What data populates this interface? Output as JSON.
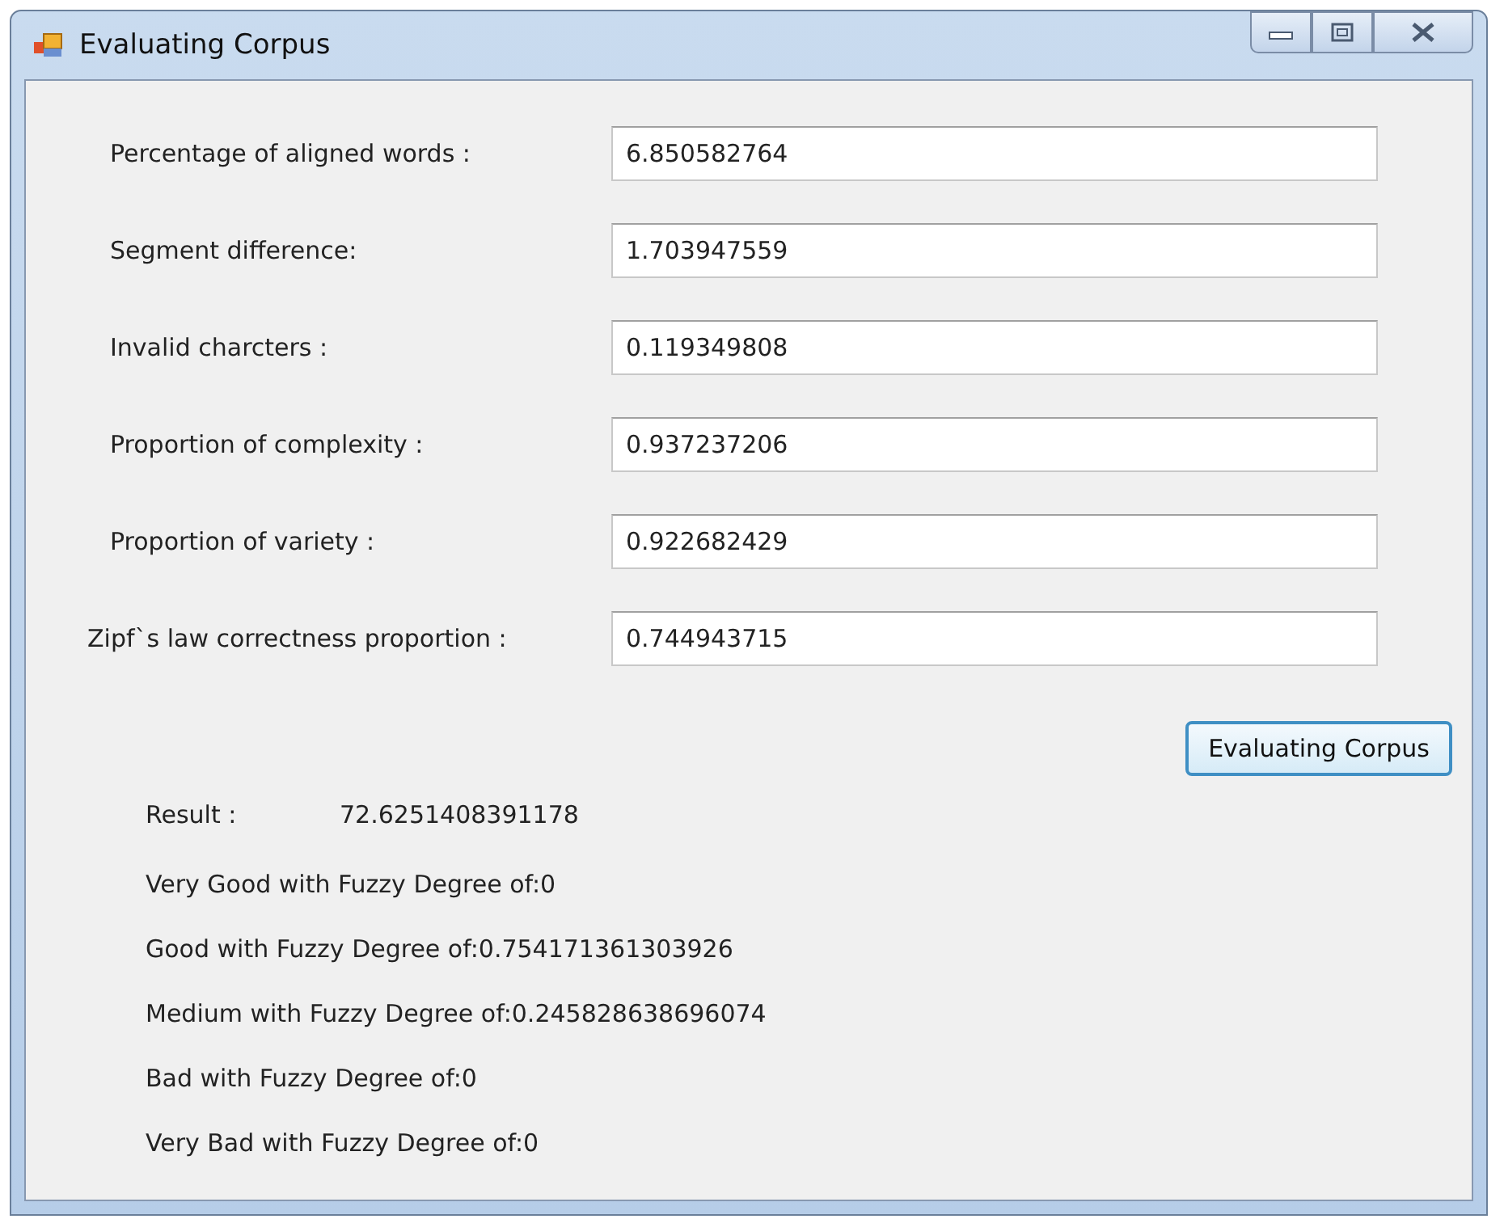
{
  "window": {
    "title": "Evaluating Corpus"
  },
  "fields": [
    {
      "label": "Percentage of aligned words :",
      "value": "6.850582764"
    },
    {
      "label": "Segment difference:",
      "value": "1.703947559"
    },
    {
      "label": "Invalid charcters :",
      "value": "0.119349808"
    },
    {
      "label": "Proportion of complexity :",
      "value": "0.937237206"
    },
    {
      "label": "Proportion of variety :",
      "value": "0.922682429"
    },
    {
      "label": "Zipf`s law correctness proportion :",
      "value": "0.744943715"
    }
  ],
  "button": {
    "label": "Evaluating Corpus"
  },
  "result": {
    "label": "Result :",
    "value": "72.6251408391178"
  },
  "fuzzy_lines": [
    "Very Good with Fuzzy Degree of:0",
    "Good with Fuzzy Degree of:0.754171361303926",
    "Medium with Fuzzy Degree of:0.245828638696074",
    "Bad with Fuzzy Degree of:0",
    "Very Bad with Fuzzy Degree of:0"
  ]
}
